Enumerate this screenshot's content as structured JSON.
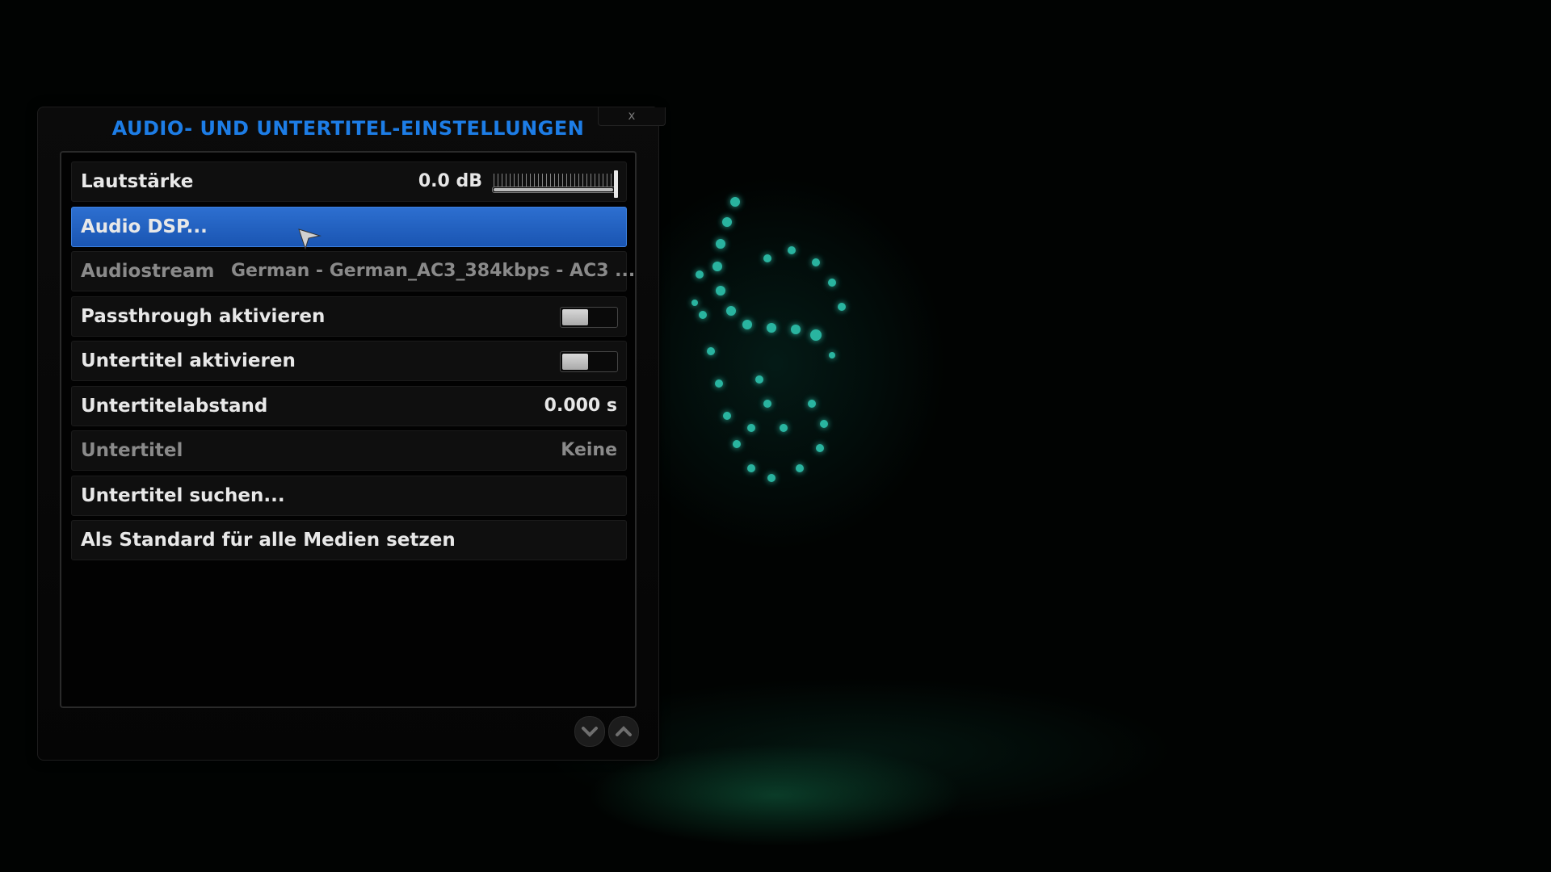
{
  "dialog": {
    "title": "AUDIO- UND UNTERTITEL-EINSTELLUNGEN",
    "close_label": "x"
  },
  "settings": [
    {
      "label": "Lautstärke",
      "value": "0.0 dB",
      "type": "slider",
      "level": 1.0
    },
    {
      "label": "Audio DSP...",
      "type": "action",
      "focused": true
    },
    {
      "label": "Audiostream",
      "value": "German - German_AC3_384kbps - AC3 ...",
      "type": "select",
      "disabled": true
    },
    {
      "label": "Passthrough aktivieren",
      "type": "toggle",
      "enabled": false
    },
    {
      "label": "Untertitel aktivieren",
      "type": "toggle",
      "enabled": false
    },
    {
      "label": "Untertitelabstand",
      "value": "0.000 s",
      "type": "value"
    },
    {
      "label": "Untertitel",
      "value": "Keine",
      "type": "select",
      "disabled": true
    },
    {
      "label": "Untertitel suchen...",
      "type": "action"
    },
    {
      "label": "Als Standard für alle Medien setzen",
      "type": "action"
    }
  ],
  "scroll": {
    "down_icon": "chevron-down-icon",
    "up_icon": "chevron-up-icon"
  },
  "colors": {
    "accent": "#1d7de6",
    "focus": "#2563c4"
  }
}
